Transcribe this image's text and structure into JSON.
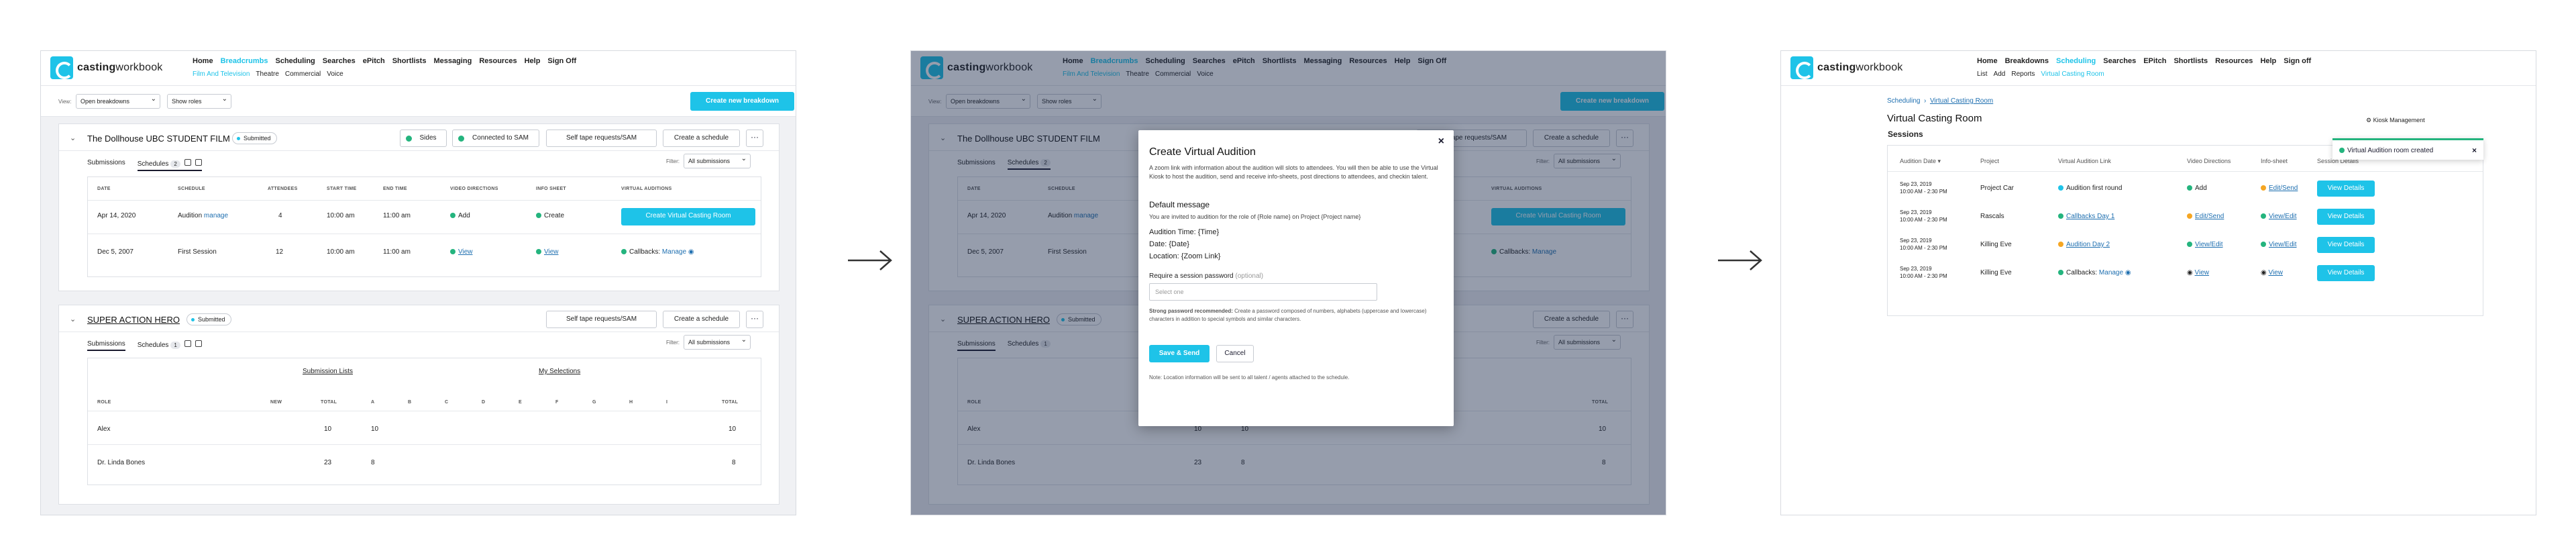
{
  "nav": {
    "logo_bold": "casting",
    "logo_rest": "workbook",
    "menu": [
      "Home",
      "Breadcrumbs",
      "Scheduling",
      "Searches",
      "ePitch",
      "Shortlists",
      "Messaging",
      "Resources",
      "Help",
      "Sign Off"
    ],
    "submenu_breakdowns": [
      "Film And Television",
      "Theatre",
      "Commercial",
      "Voice"
    ],
    "menu_s3": [
      "Home",
      "Breakdowns",
      "Scheduling",
      "Searches",
      "EPitch",
      "Shortlists",
      "Resources",
      "Help",
      "Sign off"
    ],
    "submenu_scheduling": [
      "List",
      "Add",
      "Reports",
      "Virtual Casting Room"
    ]
  },
  "filters": {
    "view_label": "View:",
    "view_value": "Open breakdowns",
    "roles_value": "Show roles",
    "create_breakdown": "Create new breakdown",
    "filter_label": "Filter:",
    "filter_value": "All submissions"
  },
  "card1": {
    "title": "The Dollhouse UBC STUDENT FILM",
    "status": "Submitted",
    "sides": "Sides",
    "sam": "Connected to SAM",
    "self_tape": "Self tape requests/SAM",
    "create_schedule": "Create a schedule",
    "tab_submissions": "Submissions",
    "tab_schedules": "Schedules",
    "schedules_count": "2",
    "headers": [
      "DATE",
      "SCHEDULE",
      "ATTENDEES",
      "START TIME",
      "END TIME",
      "VIDEO DIRECTIONS",
      "INFO SHEET",
      "VIRTUAL AUDITIONS"
    ],
    "rows": [
      {
        "date": "Apr 14, 2020",
        "schedule": "Audition",
        "manage": "manage",
        "attendees": "4",
        "start": "10:00 am",
        "end": "11:00 am",
        "video": "Add",
        "info": "Create",
        "virtual": "Create Virtual Casting Room"
      },
      {
        "date": "Dec 5, 2007",
        "schedule": "First Session",
        "manage": "",
        "attendees": "12",
        "start": "10:00 am",
        "end": "11:00 am",
        "video": "View",
        "info": "View",
        "virtual": "Callbacks:",
        "virtual_link": "Manage"
      }
    ]
  },
  "card2": {
    "title": "SUPER ACTION HERO",
    "status": "Submitted",
    "self_tape": "Self tape requests/SAM",
    "create_schedule": "Create a schedule",
    "tab_submissions": "Submissions",
    "tab_schedules": "Schedules",
    "schedules_count": "1",
    "group1": "Submission Lists",
    "group2": "My Selections",
    "headers": [
      "ROLE",
      "NEW",
      "TOTAL",
      "A",
      "B",
      "C",
      "D",
      "E",
      "F",
      "G",
      "H",
      "I",
      "TOTAL"
    ],
    "rows": [
      {
        "role": "Alex",
        "total": "10",
        "a": "10",
        "total2": "10"
      },
      {
        "role": "Dr. Linda Bones",
        "total": "23",
        "a": "8",
        "total2": "8"
      }
    ]
  },
  "modal": {
    "close": "×",
    "title": "Create Virtual Audition",
    "desc": "A zoom link with information about the audition will slots to attendees. You will then be able to use the Virtual Kiosk to host the audition, send and receive info-sheets, post directions to attendees, and checkin talent.",
    "default_heading": "Default message",
    "default_text": "You are invited to audition for the role of {Role name} on Project {Project name}",
    "line_time": "Audition Time: {Time}",
    "line_date": "Date: {Date}",
    "line_loc": "Location: {Zoom Link}",
    "pw_label": "Require a session password",
    "pw_optional": "(optional)",
    "pw_placeholder": "Select one",
    "pw_help_bold": "Strong password recommended:",
    "pw_help": "Create a password composed of numbers, alphabets (uppercase and lowercase) characters in addition to special symbols and similar characters.",
    "save": "Save & Send",
    "cancel": "Cancel",
    "note": "Note: Location information will be sent to all talent / agents attached to the schedule."
  },
  "s3": {
    "breadcrumb_parent": "Scheduling",
    "breadcrumb_current": "Virtual Casting Room",
    "page_title": "Virtual Casting Room",
    "kiosk": "Kiosk Management",
    "toast": "Virtual Audition room created",
    "toast_close": "×",
    "sessions_title": "Sessions",
    "headers": [
      "Audition Date",
      "Project",
      "Virtual Audition Link",
      "Video Directions",
      "Info-sheet",
      "Session Details"
    ],
    "rows": [
      {
        "date": "Sep 23, 2019",
        "time": "10:00 AM - 2:30 PM",
        "project": "Project Car",
        "link": "Audition first round",
        "video": "Add",
        "info": "Edit/Send",
        "details": "View Details"
      },
      {
        "date": "Sep 23, 2019",
        "time": "10:00 AM - 2:30 PM",
        "project": "Rascals",
        "link": "Callbacks Day 1",
        "video": "Edit/Send",
        "info": "View/Edit",
        "details": "View Details"
      },
      {
        "date": "Sep 23, 2019",
        "time": "10:00 AM - 2:30 PM",
        "project": "Killing Eve",
        "link": "Audition Day 2",
        "video": "View/Edit",
        "info": "View/Edit",
        "details": "View Details"
      },
      {
        "date": "Sep 23, 2019",
        "time": "10:00 AM - 2:30 PM",
        "project": "Killing Eve",
        "link": "Callbacks:",
        "link2": "Manage",
        "video": "View",
        "info": "View",
        "details": "View Details"
      }
    ]
  },
  "colors": {
    "accent": "#1ec3e8",
    "success": "#24b47e",
    "warning": "#f5a623",
    "link": "#1e6fb0"
  }
}
